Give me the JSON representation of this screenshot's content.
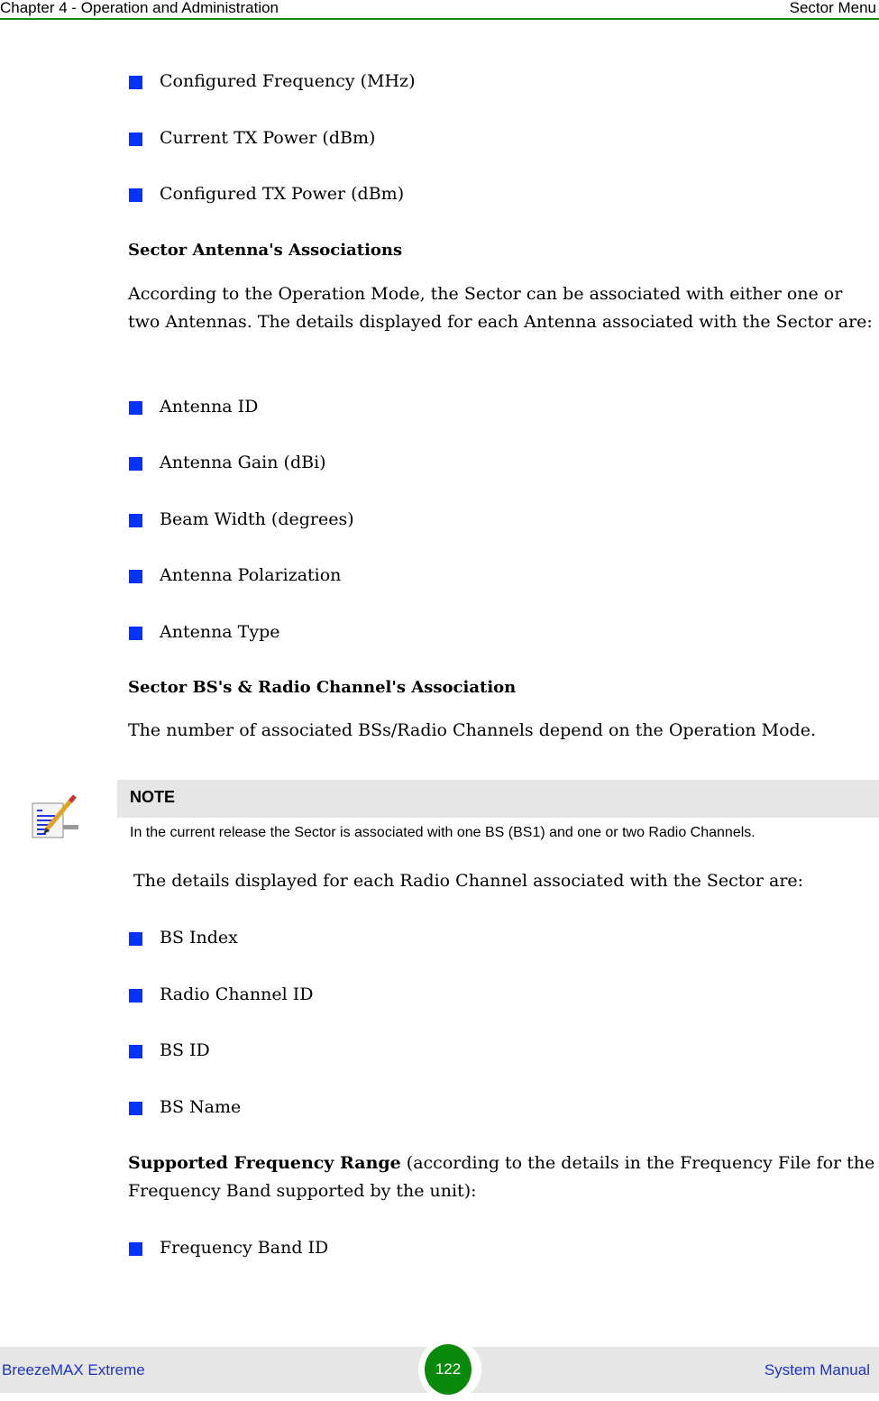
{
  "header": {
    "chapter": "Chapter 4 - Operation and Administration",
    "section": "Sector Menu"
  },
  "colors": {
    "bullet": "#0033ff",
    "header_rule": "#138a13",
    "footer_text": "#1a33cc",
    "page_badge": "#0a8a0a",
    "note_bar": "#e6e6e6"
  },
  "content": {
    "list1": [
      "Configured Frequency (MHz)",
      "Current TX Power (dBm)",
      "Configured TX Power (dBm)"
    ],
    "heading_antenna": "Sector Antenna's Associations",
    "para_antenna": "According to the Operation Mode, the Sector can be associated with either one or two Antennas. The details displayed for each Antenna associated with the Sector are:",
    "list_antenna": [
      "Antenna ID",
      "Antenna Gain (dBi)",
      "Beam Width (degrees)",
      "Antenna Polarization",
      "Antenna Type"
    ],
    "heading_bs": "Sector BS's & Radio Channel's Association",
    "para_bs": "The number of associated BSs/Radio Channels depend on the Operation Mode.",
    "note": {
      "title": "NOTE",
      "text": "In the current release the Sector is associated with one BS (BS1) and one or two Radio Channels.",
      "icon": "note-pencil-icon"
    },
    "para_radio": " The details displayed for each Radio Channel associated with the Sector are:",
    "list_radio": [
      "BS Index",
      "Radio Channel ID",
      "BS ID",
      "BS Name"
    ],
    "freq_bold": "Supported Frequency Range",
    "freq_rest": " (according to the details in the Frequency File for the Frequency Band supported by the unit):",
    "list_freq": [
      "Frequency Band ID"
    ]
  },
  "footer": {
    "product": "BreezeMAX Extreme",
    "page_number": "122",
    "manual": "System Manual"
  }
}
